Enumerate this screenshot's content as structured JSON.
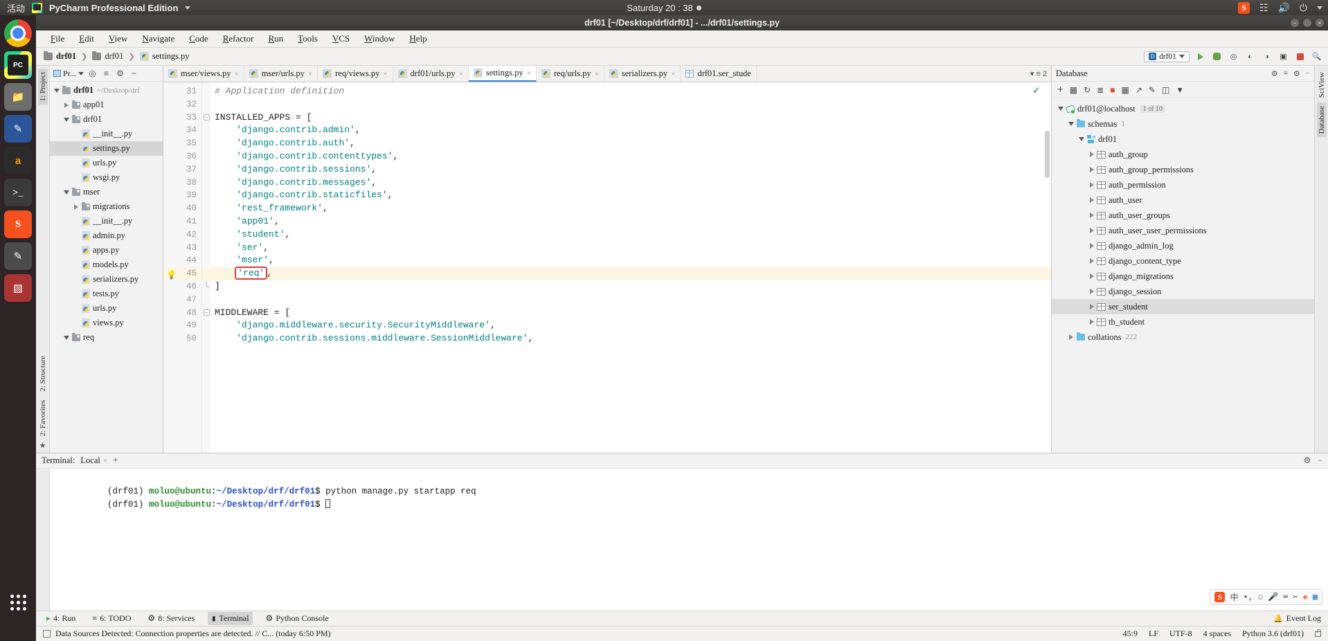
{
  "desktop": {
    "activities": "活动",
    "app_name": "PyCharm Professional Edition",
    "clock": "Saturday 20 : 38",
    "tray": [
      "sogou-icon",
      "network-icon",
      "volume-icon",
      "power-icon",
      "chevron-down-icon"
    ]
  },
  "dock": [
    {
      "name": "chrome",
      "label": ""
    },
    {
      "name": "pycharm",
      "label": ""
    },
    {
      "name": "files",
      "label": ""
    },
    {
      "name": "writer",
      "label": ""
    },
    {
      "name": "amazon",
      "label": "a"
    },
    {
      "name": "terminal",
      "label": ">_"
    },
    {
      "name": "sogou",
      "label": "S"
    },
    {
      "name": "gimp",
      "label": ""
    },
    {
      "name": "remote-desktop",
      "label": ""
    },
    {
      "name": "show-apps",
      "label": ""
    }
  ],
  "window": {
    "title": "drf01 [~/Desktop/drf/drf01] - .../drf01/settings.py",
    "buttons": [
      "minimize",
      "maximize",
      "close"
    ]
  },
  "menu": [
    "File",
    "Edit",
    "View",
    "Navigate",
    "Code",
    "Refactor",
    "Run",
    "Tools",
    "VCS",
    "Window",
    "Help"
  ],
  "navbar": {
    "breadcrumbs": [
      {
        "label": "drf01",
        "icon": "folder-icon",
        "bold": true
      },
      {
        "label": "drf01",
        "icon": "folder-icon",
        "bold": false
      },
      {
        "label": "settings.py",
        "icon": "python-file-icon",
        "bold": false
      }
    ],
    "run_config": "drf01",
    "actions": [
      "run-button",
      "debug-button",
      "coverage-button",
      "profile-button",
      "attach-button",
      "stop-button",
      "search-button"
    ]
  },
  "project_panel": {
    "title": "Pr...",
    "header_actions": [
      "target-icon",
      "collapse-icon",
      "gear-icon",
      "minimize-icon"
    ],
    "tree": [
      {
        "indent": 0,
        "arrow": "down",
        "icon": "folder-icon",
        "label": "drf01",
        "sub": "~/Desktop/drf",
        "bold": true
      },
      {
        "indent": 1,
        "arrow": "right",
        "icon": "module-folder-icon",
        "label": "app01",
        "sub": "",
        "bold": false
      },
      {
        "indent": 1,
        "arrow": "down",
        "icon": "module-folder-icon",
        "label": "drf01",
        "sub": "",
        "bold": false
      },
      {
        "indent": 2,
        "arrow": "none",
        "icon": "python-file-icon",
        "label": "__init__.py",
        "sub": "",
        "bold": false
      },
      {
        "indent": 2,
        "arrow": "none",
        "icon": "python-file-icon",
        "label": "settings.py",
        "sub": "",
        "bold": false,
        "selected": true
      },
      {
        "indent": 2,
        "arrow": "none",
        "icon": "python-file-icon",
        "label": "urls.py",
        "sub": "",
        "bold": false
      },
      {
        "indent": 2,
        "arrow": "none",
        "icon": "python-file-icon",
        "label": "wsgi.py",
        "sub": "",
        "bold": false
      },
      {
        "indent": 1,
        "arrow": "down",
        "icon": "module-folder-icon",
        "label": "mser",
        "sub": "",
        "bold": false
      },
      {
        "indent": 2,
        "arrow": "right",
        "icon": "module-folder-icon",
        "label": "migrations",
        "sub": "",
        "bold": false
      },
      {
        "indent": 2,
        "arrow": "none",
        "icon": "python-file-icon",
        "label": "__init__.py",
        "sub": "",
        "bold": false
      },
      {
        "indent": 2,
        "arrow": "none",
        "icon": "python-file-icon",
        "label": "admin.py",
        "sub": "",
        "bold": false
      },
      {
        "indent": 2,
        "arrow": "none",
        "icon": "python-file-icon",
        "label": "apps.py",
        "sub": "",
        "bold": false
      },
      {
        "indent": 2,
        "arrow": "none",
        "icon": "python-file-icon",
        "label": "models.py",
        "sub": "",
        "bold": false
      },
      {
        "indent": 2,
        "arrow": "none",
        "icon": "python-file-icon",
        "label": "serializers.py",
        "sub": "",
        "bold": false
      },
      {
        "indent": 2,
        "arrow": "none",
        "icon": "python-file-icon",
        "label": "tests.py",
        "sub": "",
        "bold": false
      },
      {
        "indent": 2,
        "arrow": "none",
        "icon": "python-file-icon",
        "label": "urls.py",
        "sub": "",
        "bold": false
      },
      {
        "indent": 2,
        "arrow": "none",
        "icon": "python-file-icon",
        "label": "views.py",
        "sub": "",
        "bold": false
      },
      {
        "indent": 1,
        "arrow": "down",
        "icon": "module-folder-icon",
        "label": "req",
        "sub": "",
        "bold": false
      }
    ],
    "vtabs": [
      "1: Project",
      "2: Structure",
      "2: Favorites"
    ]
  },
  "editor": {
    "tabs": [
      {
        "label": "mser/views.py",
        "icon": "python-file-icon",
        "active": false,
        "closable": true
      },
      {
        "label": "mser/urls.py",
        "icon": "python-file-icon",
        "active": false,
        "closable": true
      },
      {
        "label": "req/views.py",
        "icon": "python-file-icon",
        "active": false,
        "closable": true
      },
      {
        "label": "drf01/urls.py",
        "icon": "python-file-icon",
        "active": false,
        "closable": true
      },
      {
        "label": "settings.py",
        "icon": "python-file-icon",
        "active": true,
        "closable": true
      },
      {
        "label": "req/urls.py",
        "icon": "python-file-icon",
        "active": false,
        "closable": true
      },
      {
        "label": "serializers.py",
        "icon": "python-file-icon",
        "active": false,
        "closable": true
      },
      {
        "label": "drf01.ser_stude",
        "icon": "table-icon",
        "active": false,
        "closable": false
      }
    ],
    "tab_overflow_count": "2",
    "lines": [
      {
        "num": "31",
        "fold": "none",
        "highlight": false,
        "bulb": false,
        "tokens": [
          {
            "t": "comment",
            "v": "# Application definition"
          }
        ]
      },
      {
        "num": "32",
        "fold": "none",
        "highlight": false,
        "bulb": false,
        "tokens": []
      },
      {
        "num": "33",
        "fold": "start",
        "highlight": false,
        "bulb": false,
        "tokens": [
          {
            "t": "name",
            "v": "INSTALLED_APPS = ["
          }
        ]
      },
      {
        "num": "34",
        "fold": "none",
        "highlight": false,
        "bulb": false,
        "tokens": [
          {
            "t": "plain",
            "v": "    "
          },
          {
            "t": "str",
            "v": "'django.contrib.admin'"
          },
          {
            "t": "punct",
            "v": ","
          }
        ]
      },
      {
        "num": "35",
        "fold": "none",
        "highlight": false,
        "bulb": false,
        "tokens": [
          {
            "t": "plain",
            "v": "    "
          },
          {
            "t": "str",
            "v": "'django.contrib.auth'"
          },
          {
            "t": "punct",
            "v": ","
          }
        ]
      },
      {
        "num": "36",
        "fold": "none",
        "highlight": false,
        "bulb": false,
        "tokens": [
          {
            "t": "plain",
            "v": "    "
          },
          {
            "t": "str",
            "v": "'django.contrib.contenttypes'"
          },
          {
            "t": "punct",
            "v": ","
          }
        ]
      },
      {
        "num": "37",
        "fold": "none",
        "highlight": false,
        "bulb": false,
        "tokens": [
          {
            "t": "plain",
            "v": "    "
          },
          {
            "t": "str",
            "v": "'django.contrib.sessions'"
          },
          {
            "t": "punct",
            "v": ","
          }
        ]
      },
      {
        "num": "38",
        "fold": "none",
        "highlight": false,
        "bulb": false,
        "tokens": [
          {
            "t": "plain",
            "v": "    "
          },
          {
            "t": "str",
            "v": "'django.contrib.messages'"
          },
          {
            "t": "punct",
            "v": ","
          }
        ]
      },
      {
        "num": "39",
        "fold": "none",
        "highlight": false,
        "bulb": false,
        "tokens": [
          {
            "t": "plain",
            "v": "    "
          },
          {
            "t": "str",
            "v": "'django.contrib.staticfiles'"
          },
          {
            "t": "punct",
            "v": ","
          }
        ]
      },
      {
        "num": "40",
        "fold": "none",
        "highlight": false,
        "bulb": false,
        "tokens": [
          {
            "t": "plain",
            "v": "    "
          },
          {
            "t": "str",
            "v": "'rest_framework'"
          },
          {
            "t": "punct",
            "v": ","
          }
        ]
      },
      {
        "num": "41",
        "fold": "none",
        "highlight": false,
        "bulb": false,
        "tokens": [
          {
            "t": "plain",
            "v": "    "
          },
          {
            "t": "str",
            "v": "'app01'"
          },
          {
            "t": "punct",
            "v": ","
          }
        ]
      },
      {
        "num": "42",
        "fold": "none",
        "highlight": false,
        "bulb": false,
        "tokens": [
          {
            "t": "plain",
            "v": "    "
          },
          {
            "t": "str",
            "v": "'student'"
          },
          {
            "t": "punct",
            "v": ","
          }
        ]
      },
      {
        "num": "43",
        "fold": "none",
        "highlight": false,
        "bulb": false,
        "tokens": [
          {
            "t": "plain",
            "v": "    "
          },
          {
            "t": "str",
            "v": "'ser'"
          },
          {
            "t": "punct",
            "v": ","
          }
        ]
      },
      {
        "num": "44",
        "fold": "none",
        "highlight": false,
        "bulb": false,
        "tokens": [
          {
            "t": "plain",
            "v": "    "
          },
          {
            "t": "str",
            "v": "'mser'"
          },
          {
            "t": "punct",
            "v": ","
          }
        ]
      },
      {
        "num": "45",
        "fold": "none",
        "highlight": true,
        "bulb": true,
        "boxed": true,
        "tokens": [
          {
            "t": "plain",
            "v": "    "
          },
          {
            "t": "str-box",
            "v": "'req'"
          },
          {
            "t": "punct",
            "v": ","
          }
        ]
      },
      {
        "num": "46",
        "fold": "end",
        "highlight": false,
        "bulb": false,
        "tokens": [
          {
            "t": "name",
            "v": "]"
          }
        ]
      },
      {
        "num": "47",
        "fold": "none",
        "highlight": false,
        "bulb": false,
        "tokens": []
      },
      {
        "num": "48",
        "fold": "start",
        "highlight": false,
        "bulb": false,
        "tokens": [
          {
            "t": "name",
            "v": "MIDDLEWARE = ["
          }
        ]
      },
      {
        "num": "49",
        "fold": "none",
        "highlight": false,
        "bulb": false,
        "tokens": [
          {
            "t": "plain",
            "v": "    "
          },
          {
            "t": "str",
            "v": "'django.middleware.security.SecurityMiddleware'"
          },
          {
            "t": "punct",
            "v": ","
          }
        ]
      },
      {
        "num": "50",
        "fold": "none",
        "highlight": false,
        "bulb": false,
        "tokens": [
          {
            "t": "plain",
            "v": "    "
          },
          {
            "t": "str",
            "v": "'django.contrib.sessions.middleware.SessionMiddleware'"
          },
          {
            "t": "punct",
            "v": ","
          }
        ]
      }
    ]
  },
  "database": {
    "title": "Database",
    "header_actions": [
      "settings-icon",
      "collapse-icon",
      "gear-icon",
      "minimize-icon"
    ],
    "toolbar": [
      "add-icon",
      "duplicate-icon",
      "refresh-icon",
      "sync-icon",
      "stop-icon",
      "table-icon",
      "jump-icon",
      "edit-icon",
      "console-icon",
      "filter-icon"
    ],
    "tree": [
      {
        "indent": 0,
        "arrow": "down",
        "icon": "connection-icon",
        "label": "drf01@localhost",
        "badge": "1 of 10",
        "count": ""
      },
      {
        "indent": 1,
        "arrow": "down",
        "icon": "schema-folder-icon",
        "label": "schemas",
        "badge": "",
        "count": "1"
      },
      {
        "indent": 2,
        "arrow": "down",
        "icon": "database-icon",
        "label": "drf01",
        "badge": "",
        "count": ""
      },
      {
        "indent": 3,
        "arrow": "right",
        "icon": "table-icon",
        "label": "auth_group",
        "badge": "",
        "count": ""
      },
      {
        "indent": 3,
        "arrow": "right",
        "icon": "table-icon",
        "label": "auth_group_permissions",
        "badge": "",
        "count": ""
      },
      {
        "indent": 3,
        "arrow": "right",
        "icon": "table-icon",
        "label": "auth_permission",
        "badge": "",
        "count": ""
      },
      {
        "indent": 3,
        "arrow": "right",
        "icon": "table-icon",
        "label": "auth_user",
        "badge": "",
        "count": ""
      },
      {
        "indent": 3,
        "arrow": "right",
        "icon": "table-icon",
        "label": "auth_user_groups",
        "badge": "",
        "count": ""
      },
      {
        "indent": 3,
        "arrow": "right",
        "icon": "table-icon",
        "label": "auth_user_user_permissions",
        "badge": "",
        "count": ""
      },
      {
        "indent": 3,
        "arrow": "right",
        "icon": "table-icon",
        "label": "django_admin_log",
        "badge": "",
        "count": ""
      },
      {
        "indent": 3,
        "arrow": "right",
        "icon": "table-icon",
        "label": "django_content_type",
        "badge": "",
        "count": ""
      },
      {
        "indent": 3,
        "arrow": "right",
        "icon": "table-icon",
        "label": "django_migrations",
        "badge": "",
        "count": ""
      },
      {
        "indent": 3,
        "arrow": "right",
        "icon": "table-icon",
        "label": "django_session",
        "badge": "",
        "count": ""
      },
      {
        "indent": 3,
        "arrow": "right",
        "icon": "table-icon",
        "label": "ser_student",
        "badge": "",
        "count": "",
        "selected": true
      },
      {
        "indent": 3,
        "arrow": "right",
        "icon": "table-icon",
        "label": "tb_student",
        "badge": "",
        "count": ""
      },
      {
        "indent": 1,
        "arrow": "right",
        "icon": "schema-folder-icon",
        "label": "collations",
        "badge": "",
        "count": "222"
      }
    ],
    "vtabs": [
      "SciView",
      "Database"
    ]
  },
  "terminal": {
    "label": "Terminal:",
    "session": "Local",
    "add_label": "+",
    "header_actions": [
      "gear-icon",
      "minimize-icon"
    ],
    "vtab": "",
    "lines": [
      {
        "venv": "(drf01) ",
        "user": "moluo@ubuntu",
        "colon": ":",
        "path": "~/Desktop/drf/drf01",
        "prompt": "$ ",
        "cmd": "python manage.py startapp req",
        "cursor": false
      },
      {
        "venv": "(drf01) ",
        "user": "moluo@ubuntu",
        "colon": ":",
        "path": "~/Desktop/drf/drf01",
        "prompt": "$ ",
        "cmd": "",
        "cursor": true
      }
    ],
    "ime": {
      "logo": "S",
      "items": [
        "中",
        "•,",
        "☺",
        "🎤",
        "⌨",
        "✂",
        "🔧",
        "▦"
      ]
    }
  },
  "bottombar": {
    "items": [
      {
        "label": "4: Run",
        "icon": "run-icon",
        "active": false
      },
      {
        "label": "6: TODO",
        "icon": "list-icon",
        "active": false
      },
      {
        "label": "8: Services",
        "icon": "services-icon",
        "active": false
      },
      {
        "label": "Terminal",
        "icon": "terminal-icon",
        "active": true
      },
      {
        "label": "Python Console",
        "icon": "python-icon",
        "active": false
      }
    ],
    "event_log": "Event Log"
  },
  "statusbar": {
    "message": "Data Sources Detected: Connection properties are detected. // C... (today 6:50 PM)",
    "right": [
      "45:9",
      "LF",
      "UTF-8",
      "4 spaces",
      "Python 3.6 (drf01)"
    ],
    "lock": "lock-icon"
  }
}
